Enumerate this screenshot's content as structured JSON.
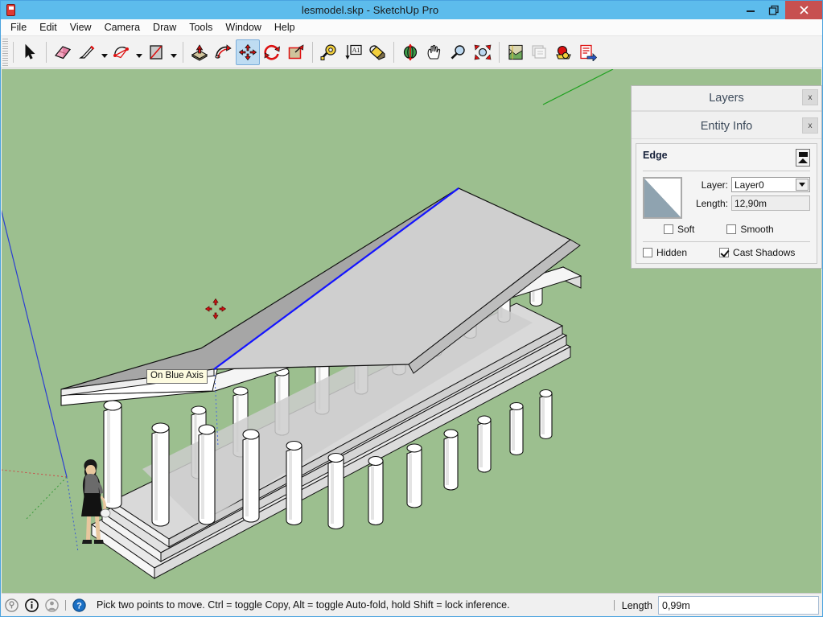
{
  "window": {
    "title": "lesmodel.skp - SketchUp Pro",
    "app_icon": "sketchup-icon",
    "controls": {
      "minimize": "–",
      "restore": "❐",
      "close": "✕"
    }
  },
  "menubar": {
    "items": [
      "File",
      "Edit",
      "View",
      "Camera",
      "Draw",
      "Tools",
      "Window",
      "Help"
    ]
  },
  "toolbar": {
    "tools": [
      {
        "name": "select-tool",
        "label": "Select",
        "active": false,
        "dropdown": false
      },
      {
        "name": "eraser-tool",
        "label": "Eraser",
        "active": false,
        "dropdown": false
      },
      {
        "name": "line-tool",
        "label": "Line",
        "active": false,
        "dropdown": true
      },
      {
        "name": "arc-tool",
        "label": "Arc",
        "active": false,
        "dropdown": true
      },
      {
        "name": "rectangle-tool",
        "label": "Rectangle",
        "active": false,
        "dropdown": true
      },
      {
        "name": "pushpull-tool",
        "label": "Push/Pull",
        "active": false,
        "dropdown": false
      },
      {
        "name": "followme-tool",
        "label": "Follow Me",
        "active": false,
        "dropdown": false
      },
      {
        "name": "move-tool",
        "label": "Move",
        "active": true,
        "dropdown": false
      },
      {
        "name": "rotate-tool",
        "label": "Rotate",
        "active": false,
        "dropdown": false
      },
      {
        "name": "scale-tool",
        "label": "Scale",
        "active": false,
        "dropdown": false
      },
      {
        "name": "tape-measure-tool",
        "label": "Tape Measure",
        "active": false,
        "dropdown": false
      },
      {
        "name": "dimension-tool",
        "label": "Dimension",
        "active": false,
        "dropdown": false
      },
      {
        "name": "paint-bucket-tool",
        "label": "Paint Bucket",
        "active": false,
        "dropdown": false
      },
      {
        "name": "orbit-tool",
        "label": "Orbit",
        "active": false,
        "dropdown": false
      },
      {
        "name": "pan-tool",
        "label": "Pan",
        "active": false,
        "dropdown": false
      },
      {
        "name": "zoom-tool",
        "label": "Zoom",
        "active": false,
        "dropdown": false
      },
      {
        "name": "zoom-extents-tool",
        "label": "Zoom Extents",
        "active": false,
        "dropdown": false
      },
      {
        "name": "position-camera-tool",
        "label": "Position Camera",
        "active": false,
        "dropdown": false
      },
      {
        "name": "previous-scene-tool",
        "label": "Previous",
        "active": false,
        "dropdown": false
      },
      {
        "name": "shadows-tool",
        "label": "Shadows",
        "active": false,
        "dropdown": false
      },
      {
        "name": "export-tool",
        "label": "Export",
        "active": false,
        "dropdown": false
      }
    ]
  },
  "viewport": {
    "background_color": "#9cbf8f",
    "inference_tooltip": "On Blue Axis",
    "cursor": "move-cursor",
    "axes": {
      "blue_axis_color": "#2b3fd1",
      "red_axis_color": "#cc2222",
      "green_axis_color": "#1fa11f"
    },
    "model": {
      "name": "greek-temple-model",
      "roof_dark_color": "#a6a6a6",
      "roof_light_color": "#cfcfcf",
      "selected_edge_color": "#1414ff"
    }
  },
  "panels": {
    "layers": {
      "title": "Layers",
      "close_label": "x"
    },
    "entity_info": {
      "title": "Entity Info",
      "close_label": "x",
      "entity_type": "Edge",
      "thumbnail": "edge-preview-thumbnail",
      "fields": [
        {
          "label": "Layer:",
          "value": "Layer0",
          "type": "combobox"
        },
        {
          "label": "Length:",
          "value": "12,90m",
          "type": "readonly-text"
        }
      ],
      "checkboxes": [
        {
          "label": "Soft",
          "checked": false
        },
        {
          "label": "Smooth",
          "checked": false
        },
        {
          "label": "Hidden",
          "checked": false
        },
        {
          "label": "Cast Shadows",
          "checked": true
        }
      ]
    }
  },
  "statusbar": {
    "icons": [
      "bulb-icon",
      "info-icon",
      "person-icon",
      "help-icon"
    ],
    "message": "Pick two points to move.  Ctrl = toggle Copy, Alt = toggle Auto-fold, hold Shift = lock inference.",
    "measurement": {
      "label": "Length",
      "value": "0,99m"
    }
  }
}
